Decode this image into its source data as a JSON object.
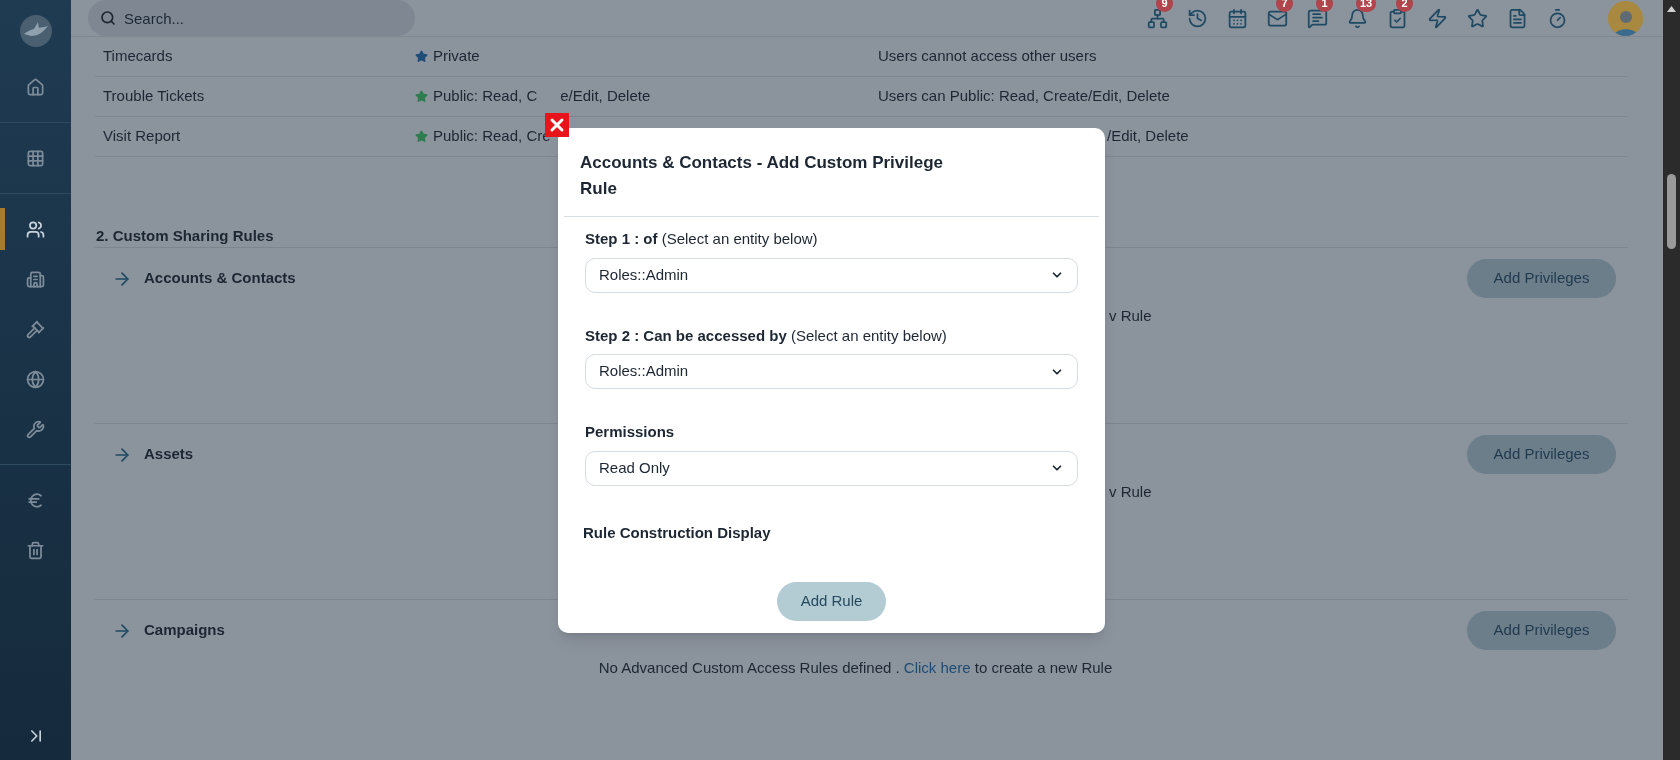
{
  "sidebar": {
    "items": [
      {
        "selected": false
      },
      {
        "selected": false
      },
      {
        "selected": true
      },
      {
        "selected": false
      },
      {
        "selected": false
      },
      {
        "selected": false
      },
      {
        "selected": false
      },
      {
        "selected": false
      },
      {
        "selected": false
      }
    ]
  },
  "search": {
    "placeholder": "Search..."
  },
  "toolbar": {
    "badges": [
      "9",
      "7",
      "1",
      "13",
      "2"
    ]
  },
  "table": {
    "rows": [
      {
        "module": "Timecards",
        "access": [
          "Private"
        ],
        "color": "#1f4d7a",
        "description": "Users cannot access other users",
        "clipped_left": false
      },
      {
        "module": "Trouble Tickets",
        "access": [
          "Public: Read, C",
          "e/Edit, Delete"
        ],
        "color": "#2e7d4f",
        "description": "Users can Public: Read, Create/Edit, Delete",
        "clipped_left": false
      },
      {
        "module": "Visit Report",
        "access": [
          "Public: Read, Cre"
        ],
        "color": "#2e7d4f",
        "description": "/Edit, Delete",
        "clipped_left": true
      }
    ]
  },
  "section_title": "2. Custom Sharing Rules",
  "sections": [
    {
      "title": "Accounts & Contacts",
      "button": "Add Privileges",
      "message_tail": "v Rule"
    },
    {
      "title": "Assets",
      "button": "Add Privileges",
      "message_tail": "v Rule"
    },
    {
      "title": "Campaigns",
      "button": "Add Privileges",
      "message": {
        "before": "No Advanced Custom Access Rules defined .",
        "link": "Click here",
        "after": "to create a new Rule"
      }
    }
  ],
  "modal": {
    "title": "Accounts & Contacts - Add Custom Privilege Rule",
    "fields": [
      {
        "label": "**Step 1 : of** (Select an entity below)",
        "value": "Roles::Admin"
      },
      {
        "label": "**Step 2 : Can be accessed by** (Select an entity below)",
        "value": "Roles::Admin"
      },
      {
        "label": "**Permissions**",
        "value": "Read Only"
      }
    ],
    "display_label": "Rule Construction Display",
    "submit": "Add Rule"
  }
}
